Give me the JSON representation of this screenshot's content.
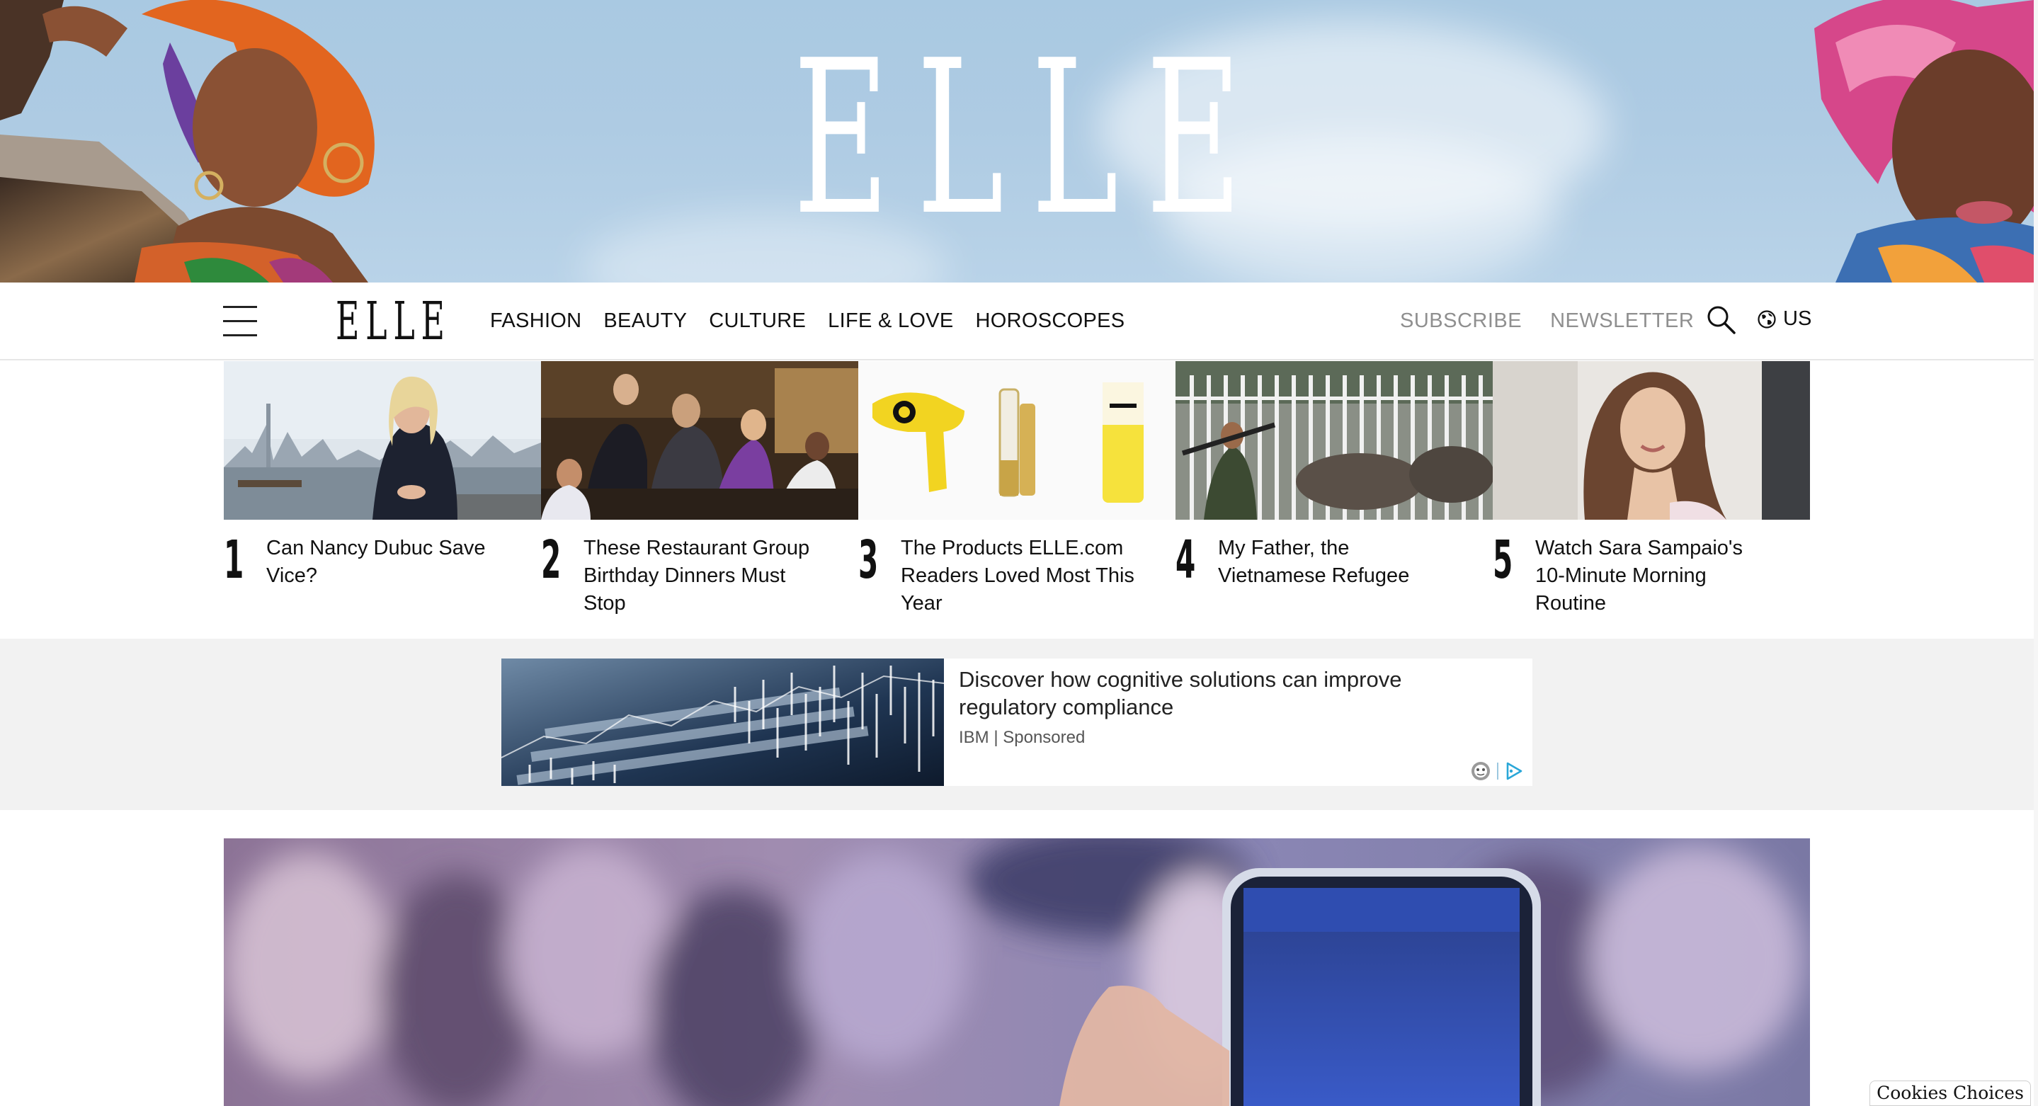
{
  "hero": {
    "logo_text": "ELLE",
    "sky_color": "#aecbe3"
  },
  "nav": {
    "menu_icon": "hamburger-menu-icon",
    "logo_text": "ELLE",
    "links": [
      "FASHION",
      "BEAUTY",
      "CULTURE",
      "LIFE & LOVE",
      "HOROSCOPES"
    ],
    "subscribe_label": "SUBSCRIBE",
    "newsletter_label": "NEWSLETTER",
    "search_icon": "search-icon",
    "region_icon": "globe-icon",
    "region_label": "US"
  },
  "trending": [
    {
      "number": "1",
      "title": "Can Nancy Dubuc Save Vice?"
    },
    {
      "number": "2",
      "title": "These Restaurant Group Birthday Dinners Must Stop"
    },
    {
      "number": "3",
      "title": "The Products ELLE.com Readers Loved Most This Year"
    },
    {
      "number": "4",
      "title": "My Father, the Vietnamese Refugee"
    },
    {
      "number": "5",
      "title": "Watch Sara Sampaio's 10-Minute Morning Routine"
    }
  ],
  "ad": {
    "headline": "Discover how cognitive solutions can improve regulatory compliance",
    "source": "IBM | Sponsored",
    "icons": [
      "adchoices-face-icon",
      "adchoices-triangle-icon"
    ]
  },
  "cookies": {
    "label": "Cookies Choices"
  }
}
